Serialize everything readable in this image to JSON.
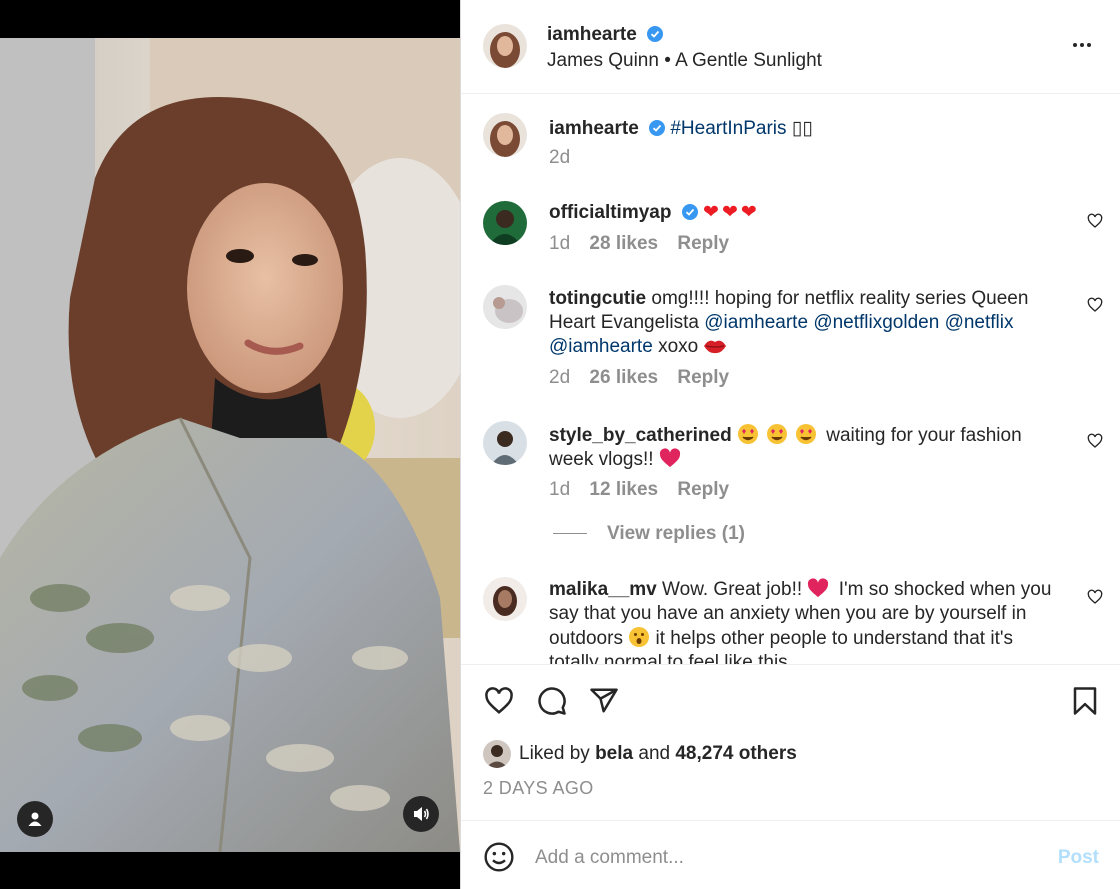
{
  "colors": {
    "link": "#00376b",
    "verified": "#3897f0",
    "muted": "#8e8e8e",
    "heart": "#ed4956",
    "post_disabled": "#b2dffc"
  },
  "header": {
    "username": "iamhearte",
    "verified_icon": "verified-badge-icon",
    "audio": "James Quinn • A Gentle Sunlight",
    "more_icon": "more-options-icon"
  },
  "caption": {
    "username": "iamhearte",
    "hashtag": "#HeartInParis",
    "flags": "▯▯",
    "time": "2d"
  },
  "comments": [
    {
      "username": "officialtimyap",
      "verified": true,
      "text_emoji": "❤❤❤",
      "time": "1d",
      "likes": "28 likes",
      "reply": "Reply"
    },
    {
      "username": "totingcutie",
      "text_a": "omg!!!! hoping for netflix reality series Queen Heart Evangelista",
      "mention1": "@iamhearte",
      "mention2": "@netflixgolden",
      "mention3": "@netflix",
      "mention4": "@iamhearte",
      "text_b": "xoxo",
      "time": "2d",
      "likes": "26 likes",
      "reply": "Reply"
    },
    {
      "username": "style_by_catherined",
      "text": "waiting for your fashion week vlogs!!",
      "time": "1d",
      "likes": "12 likes",
      "reply": "Reply"
    },
    {
      "username": "malika__mv",
      "text_a": "Wow. Great job!!",
      "text_b": "I'm so shocked when you say that you have an anxiety when you are by yourself in outdoors",
      "text_c": "it helps other people to understand that it's totally normal to feel like this"
    }
  ],
  "view_replies": "View replies (1)",
  "liked_by": {
    "prefix": "Liked by",
    "user": "bela",
    "and": "and",
    "others": "48,274 others"
  },
  "time_ago": "2 DAYS AGO",
  "add_comment": {
    "placeholder": "Add a comment...",
    "post_label": "Post"
  }
}
